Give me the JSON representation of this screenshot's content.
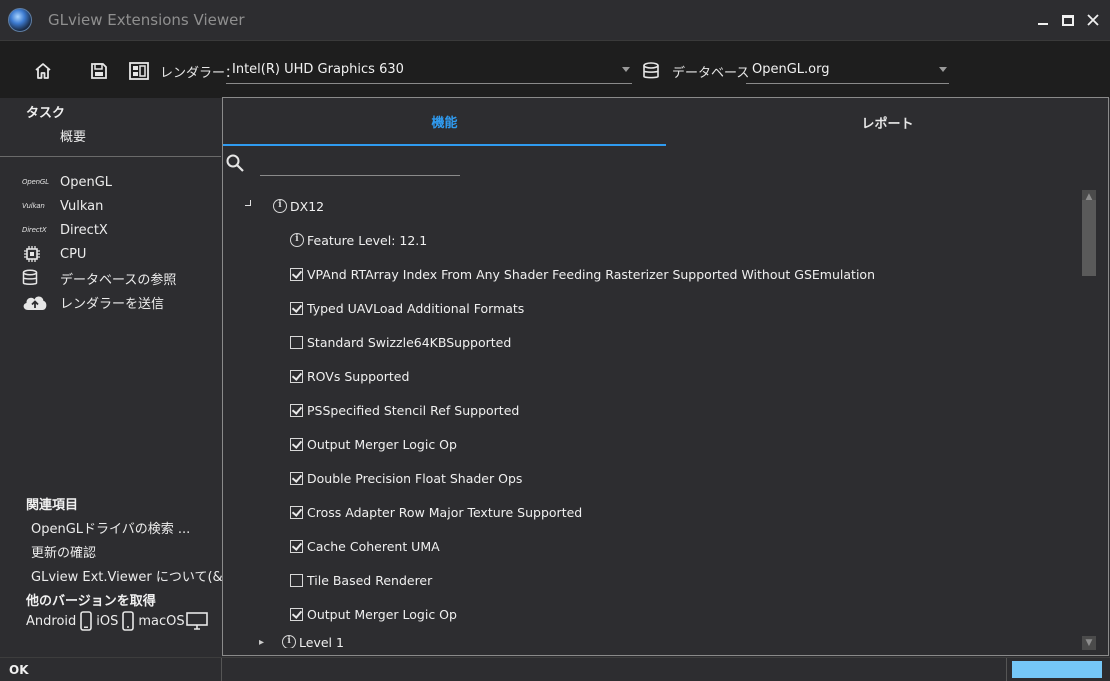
{
  "window": {
    "title": "GLview Extensions Viewer"
  },
  "toolbar": {
    "renderer_label": "レンダラー：",
    "renderer_value": "Intel(R) UHD Graphics 630",
    "database_label": "データベース",
    "database_value": "OpenGL.org"
  },
  "sidebar": {
    "tasks_heading": "タスク",
    "overview": "概要",
    "nav": [
      {
        "label": "OpenGL",
        "icon": "opengl-logo"
      },
      {
        "label": "Vulkan",
        "icon": "vulkan-logo"
      },
      {
        "label": "DirectX",
        "icon": "directx-logo"
      },
      {
        "label": "CPU",
        "icon": "cpu-icon"
      },
      {
        "label": "データベースの参照",
        "icon": "database-icon"
      },
      {
        "label": "レンダラーを送信",
        "icon": "cloud-upload-icon"
      }
    ],
    "logos": {
      "opengl": "OpenGL",
      "vulkan": "Vulkan",
      "directx": "DirectX"
    },
    "related_heading": "関連項目",
    "related": [
      "OpenGLドライバの検索 ...",
      "更新の確認",
      "GLview Ext.Viewer について(&A)"
    ],
    "other_versions_heading": "他のバージョンを取得",
    "platforms": {
      "android": "Android",
      "ios": "iOS",
      "macos": "macOS"
    }
  },
  "tabs": {
    "features": "機能",
    "report": "レポート"
  },
  "search": {
    "placeholder": ""
  },
  "tree": {
    "root": "DX12",
    "feature_level": "Feature Level: 12.1",
    "items": [
      {
        "label": "VPAnd RTArray Index From Any Shader Feeding Rasterizer Supported Without GSEmulation",
        "checked": true
      },
      {
        "label": "Typed UAVLoad Additional Formats",
        "checked": true
      },
      {
        "label": "Standard Swizzle64KBSupported",
        "checked": false
      },
      {
        "label": "ROVs Supported",
        "checked": true
      },
      {
        "label": "PSSpecified Stencil Ref Supported",
        "checked": true
      },
      {
        "label": "Output Merger Logic Op",
        "checked": true
      },
      {
        "label": "Double Precision Float Shader Ops",
        "checked": true
      },
      {
        "label": "Cross Adapter Row Major Texture Supported",
        "checked": true
      },
      {
        "label": "Cache Coherent UMA",
        "checked": true
      },
      {
        "label": "Tile Based Renderer",
        "checked": false
      },
      {
        "label": "Output Merger Logic Op",
        "checked": true
      }
    ],
    "next_node": "Level 1"
  },
  "status": {
    "text": "OK",
    "progress": 1.0
  },
  "colors": {
    "accent": "#2f9bf0",
    "progress": "#75c7f7",
    "background": "#2d2d30",
    "toolbar": "#1e1e1e"
  }
}
